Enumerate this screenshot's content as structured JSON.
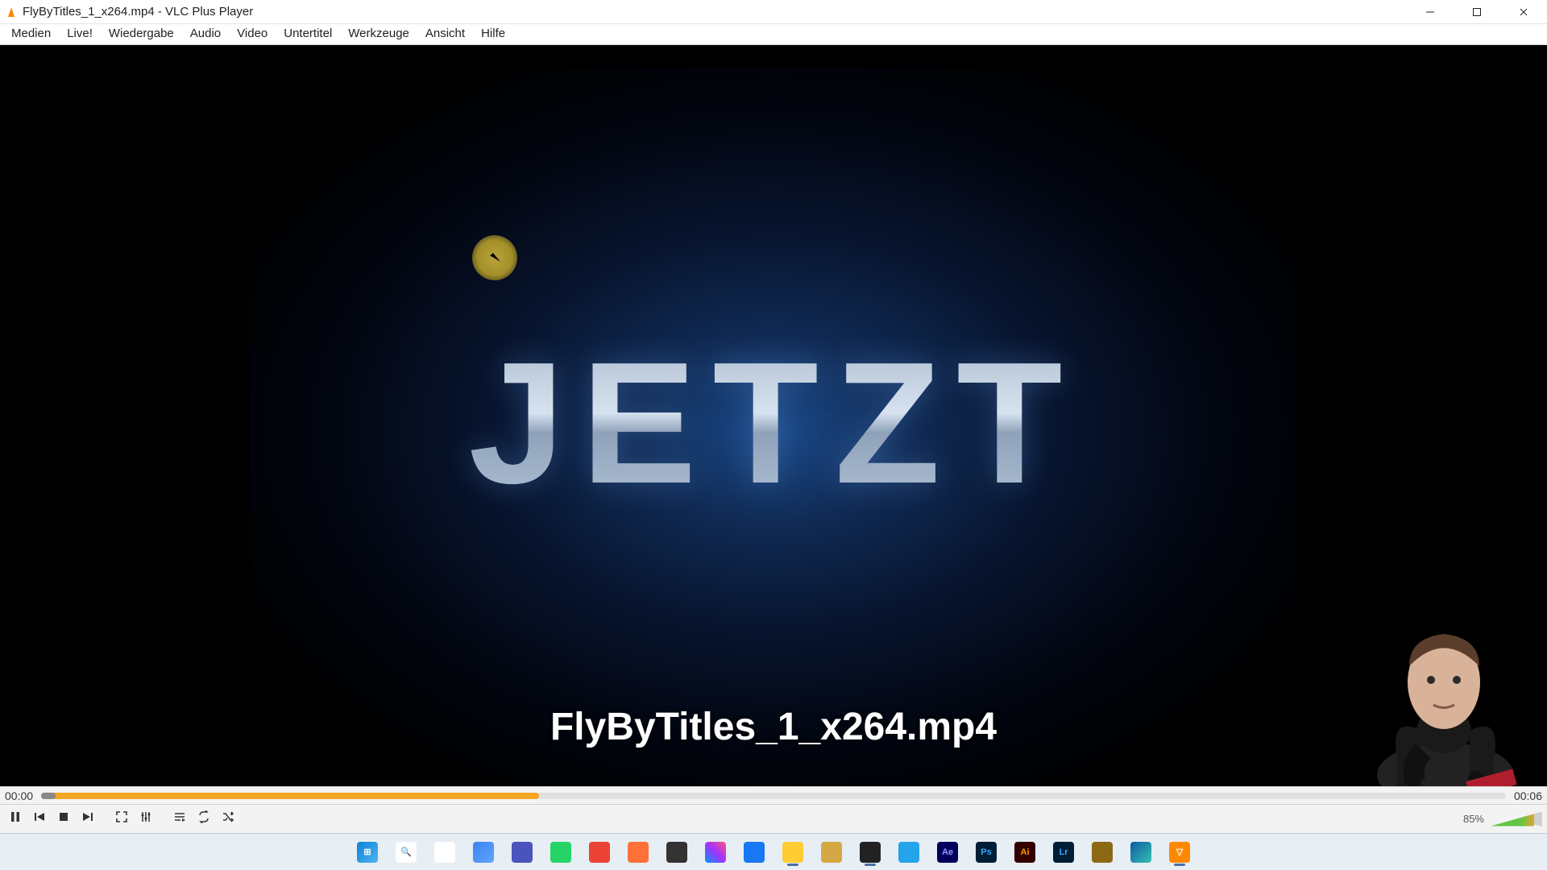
{
  "titlebar": {
    "title": "FlyByTitles_1_x264.mp4 - VLC Plus Player"
  },
  "menu": {
    "items": [
      "Medien",
      "Live!",
      "Wiedergabe",
      "Audio",
      "Video",
      "Untertitel",
      "Werkzeuge",
      "Ansicht",
      "Hilfe"
    ]
  },
  "video": {
    "main_text": "JETZT",
    "osd_filename": "FlyByTitles_1_x264.mp4"
  },
  "seek": {
    "current_time": "00:00",
    "total_time": "00:06",
    "buffered_pct": 34,
    "played_pct": 1
  },
  "controls": {
    "buttons": [
      {
        "name": "pause-button",
        "icon": "pause-icon"
      },
      {
        "name": "previous-button",
        "icon": "skip-previous-icon"
      },
      {
        "name": "stop-button",
        "icon": "stop-icon"
      },
      {
        "name": "next-button",
        "icon": "skip-next-icon"
      },
      {
        "name": "fullscreen-button",
        "icon": "fullscreen-icon"
      },
      {
        "name": "extended-settings-button",
        "icon": "equalizer-icon"
      },
      {
        "name": "playlist-button",
        "icon": "playlist-icon"
      },
      {
        "name": "loop-button",
        "icon": "loop-icon"
      },
      {
        "name": "shuffle-button",
        "icon": "shuffle-icon"
      }
    ],
    "volume_pct": 85,
    "volume_label": "85%"
  },
  "taskbar": {
    "items": [
      {
        "name": "start-button",
        "class": "i-start",
        "label": "⊞"
      },
      {
        "name": "search-button",
        "class": "i-search",
        "label": "🔍"
      },
      {
        "name": "taskview-button",
        "class": "i-taskview",
        "label": "▭"
      },
      {
        "name": "widgets-button",
        "class": "i-widgets",
        "label": ""
      },
      {
        "name": "teams-app",
        "class": "i-teams",
        "label": ""
      },
      {
        "name": "whatsapp-app",
        "class": "i-whatsapp",
        "label": ""
      },
      {
        "name": "gmail-app",
        "class": "i-gmail",
        "label": ""
      },
      {
        "name": "firefox-app",
        "class": "i-firefox",
        "label": ""
      },
      {
        "name": "discord-app",
        "class": "i-discord",
        "label": ""
      },
      {
        "name": "messenger-app",
        "class": "i-messenger",
        "label": ""
      },
      {
        "name": "facebook-app",
        "class": "i-facebook",
        "label": ""
      },
      {
        "name": "explorer-app",
        "class": "i-explorer",
        "label": "",
        "active": true
      },
      {
        "name": "app1",
        "class": "i-app1",
        "label": ""
      },
      {
        "name": "obs-app",
        "class": "i-obs",
        "label": "",
        "active": true
      },
      {
        "name": "vscode-app",
        "class": "i-vscode",
        "label": ""
      },
      {
        "name": "aftereffects-app",
        "class": "i-ae",
        "label": "Ae"
      },
      {
        "name": "photoshop-app",
        "class": "i-ps",
        "label": "Ps"
      },
      {
        "name": "illustrator-app",
        "class": "i-ai",
        "label": "Ai"
      },
      {
        "name": "lightroom-app",
        "class": "i-lr",
        "label": "Lr"
      },
      {
        "name": "app2",
        "class": "i-app2",
        "label": ""
      },
      {
        "name": "edge-app",
        "class": "i-edge",
        "label": ""
      },
      {
        "name": "vlc-app",
        "class": "i-vlc",
        "label": "▽",
        "active": true
      }
    ]
  }
}
